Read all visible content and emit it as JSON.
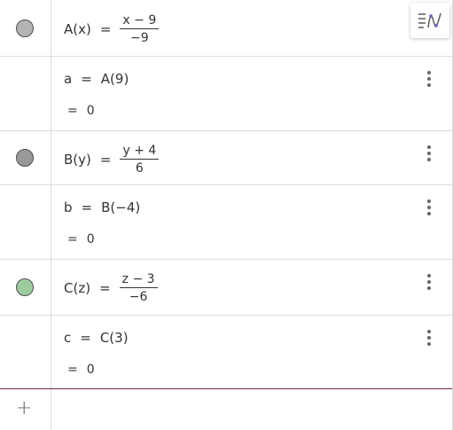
{
  "colors": {
    "marble_a": "#b4b4b4",
    "marble_b": "#999999",
    "marble_c": "#9ccc9c",
    "divider": "#dcdcdc",
    "input_border": "#6e2a3a"
  },
  "toolbar": {
    "algebra_icon": "algebra-view-settings-icon"
  },
  "rows": [
    {
      "name": "A(x)",
      "eq": "=",
      "num": "x − 9",
      "den": "−9"
    },
    {
      "def": "a",
      "eq": "=",
      "expr": "A(9)",
      "result_eq": "=",
      "result": "0"
    },
    {
      "name": "B(y)",
      "eq": "=",
      "num": "y + 4",
      "den": "6"
    },
    {
      "def": "b",
      "eq": "=",
      "expr": "B(−4)",
      "result_eq": "=",
      "result": "0"
    },
    {
      "name": "C(z)",
      "eq": "=",
      "num": "z − 3",
      "den": "−6"
    },
    {
      "def": "c",
      "eq": "=",
      "expr": "C(3)",
      "result_eq": "=",
      "result": "0"
    }
  ],
  "input": {
    "plus_label": "+"
  }
}
